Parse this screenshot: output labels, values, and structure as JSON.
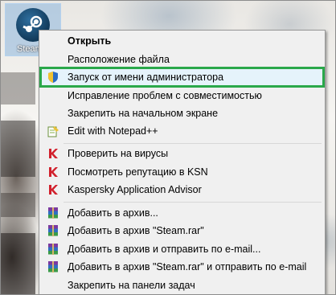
{
  "desktop": {
    "icon_label": "Steam"
  },
  "context_menu": {
    "items": [
      {
        "label": "Открыть",
        "bold": true,
        "icon": "",
        "highlighted": false
      },
      {
        "label": "Расположение файла",
        "icon": "",
        "highlighted": false
      },
      {
        "label": "Запуск от имени администратора",
        "icon": "uac-shield-icon",
        "highlighted": true
      },
      {
        "label": "Исправление проблем с совместимостью",
        "icon": "",
        "highlighted": false
      },
      {
        "label": "Закрепить на начальном экране",
        "icon": "",
        "highlighted": false
      },
      {
        "label": "Edit with Notepad++",
        "icon": "notepad-plus-plus-icon",
        "highlighted": false
      },
      {
        "label": "Проверить на вирусы",
        "icon": "kaspersky-icon",
        "highlighted": false
      },
      {
        "label": "Посмотреть репутацию в KSN",
        "icon": "kaspersky-icon",
        "highlighted": false
      },
      {
        "label": "Kaspersky Application Advisor",
        "icon": "kaspersky-icon",
        "highlighted": false
      },
      {
        "label": "Добавить в архив...",
        "icon": "winrar-icon",
        "highlighted": false
      },
      {
        "label": "Добавить в архив \"Steam.rar\"",
        "icon": "winrar-icon",
        "highlighted": false
      },
      {
        "label": "Добавить в архив и отправить по e-mail...",
        "icon": "winrar-icon",
        "highlighted": false
      },
      {
        "label": "Добавить в архив \"Steam.rar\" и отправить по e-mail",
        "icon": "winrar-icon",
        "highlighted": false
      },
      {
        "label": "Закрепить на панели задач",
        "icon": "",
        "highlighted": false
      }
    ]
  },
  "colors": {
    "highlight_outline": "#2aa84a",
    "highlight_fill": "#e5f3fb",
    "kaspersky_red": "#d11f2b"
  }
}
